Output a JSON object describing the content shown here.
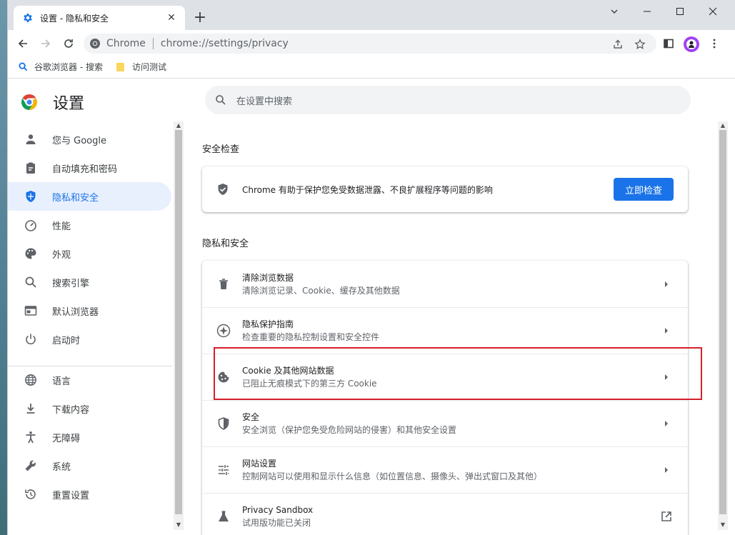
{
  "window": {
    "tab_title": "设置 - 隐私和安全",
    "new_tab": "+",
    "close_tab": "✕"
  },
  "toolbar": {
    "site_label": "Chrome",
    "url": "chrome://settings/privacy"
  },
  "bookmarks": [
    {
      "label": "谷歌浏览器 - 搜索",
      "icon": "search-icon"
    },
    {
      "label": "访问测试",
      "icon": "folder-icon"
    }
  ],
  "settings": {
    "title": "设置",
    "search_placeholder": "在设置中搜索"
  },
  "nav": {
    "items": [
      {
        "label": "您与 Google",
        "icon": "person-icon"
      },
      {
        "label": "自动填充和密码",
        "icon": "clipboard-icon"
      },
      {
        "label": "隐私和安全",
        "icon": "shield-icon",
        "active": true
      },
      {
        "label": "性能",
        "icon": "speedometer-icon"
      },
      {
        "label": "外观",
        "icon": "palette-icon"
      },
      {
        "label": "搜索引擎",
        "icon": "search-icon"
      },
      {
        "label": "默认浏览器",
        "icon": "browser-icon"
      },
      {
        "label": "启动时",
        "icon": "power-icon"
      },
      {
        "label": "语言",
        "icon": "globe-icon"
      },
      {
        "label": "下载内容",
        "icon": "download-icon"
      },
      {
        "label": "无障碍",
        "icon": "accessibility-icon"
      },
      {
        "label": "系统",
        "icon": "wrench-icon"
      },
      {
        "label": "重置设置",
        "icon": "restore-icon"
      }
    ]
  },
  "safety_check": {
    "section_title": "安全检查",
    "text": "Chrome 有助于保护您免受数据泄露、不良扩展程序等问题的影响",
    "button": "立即检查"
  },
  "privacy": {
    "section_title": "隐私和安全",
    "rows": [
      {
        "title": "清除浏览数据",
        "subtitle": "清除浏览记录、Cookie、缓存及其他数据",
        "icon": "trash-icon"
      },
      {
        "title": "隐私保护指南",
        "subtitle": "检查重要的隐私控制设置和安全控件",
        "icon": "compass-icon"
      },
      {
        "title": "Cookie 及其他网站数据",
        "subtitle": "已阻止无痕模式下的第三方 Cookie",
        "icon": "cookie-icon"
      },
      {
        "title": "安全",
        "subtitle": "安全浏览（保护您免受危险网站的侵害）和其他安全设置",
        "icon": "shield-half-icon"
      },
      {
        "title": "网站设置",
        "subtitle": "控制网站可以使用和显示什么信息（如位置信息、摄像头、弹出式窗口及其他）",
        "icon": "tune-icon"
      },
      {
        "title": "Privacy Sandbox",
        "subtitle": "试用版功能已关闭",
        "icon": "flask-icon"
      }
    ]
  },
  "colors": {
    "accent": "#1a73e8",
    "highlight_box": "#d6202a"
  }
}
